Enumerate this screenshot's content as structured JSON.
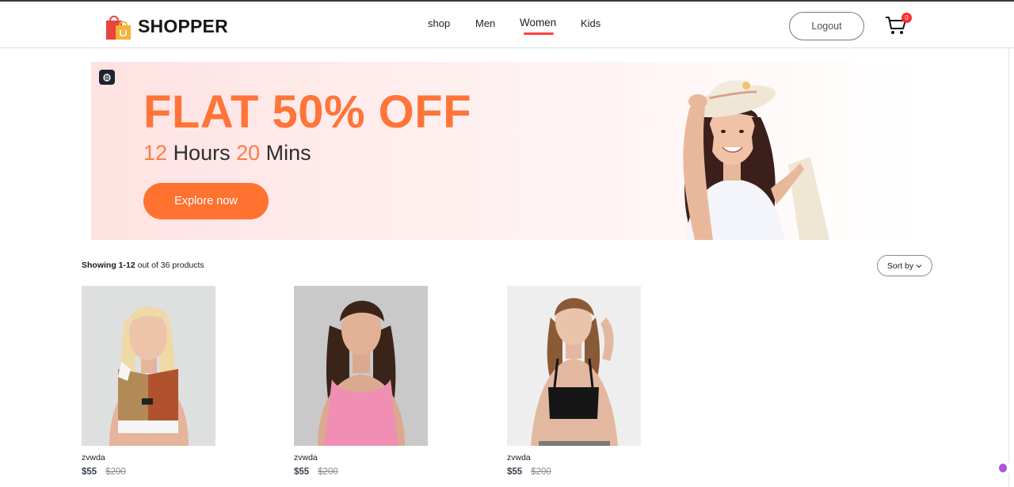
{
  "brand": {
    "name": "SHOPPER"
  },
  "nav": {
    "items": [
      {
        "label": "shop"
      },
      {
        "label": "Men"
      },
      {
        "label": "Women"
      },
      {
        "label": "Kids"
      }
    ],
    "active": "Women"
  },
  "header": {
    "logout_label": "Logout",
    "cart_count": "0"
  },
  "banner": {
    "title": "FLAT 50% OFF",
    "timer_hours": "12",
    "timer_hours_label": "Hours",
    "timer_mins": "20",
    "timer_mins_label": "Mins",
    "cta_label": "Explore now"
  },
  "listing": {
    "showing_range": "Showing 1-12",
    "showing_rest": "out of 36 products",
    "sort_label": "Sort by"
  },
  "products": [
    {
      "name": "zvwda",
      "new_price": "$55",
      "old_price": "$200"
    },
    {
      "name": "zvwda",
      "new_price": "$55",
      "old_price": "$200"
    },
    {
      "name": "zvwda",
      "new_price": "$55",
      "old_price": "$200"
    }
  ],
  "colors": {
    "accent": "#ff4141",
    "banner_orange": "#ff7438",
    "cta": "#ff7230"
  }
}
